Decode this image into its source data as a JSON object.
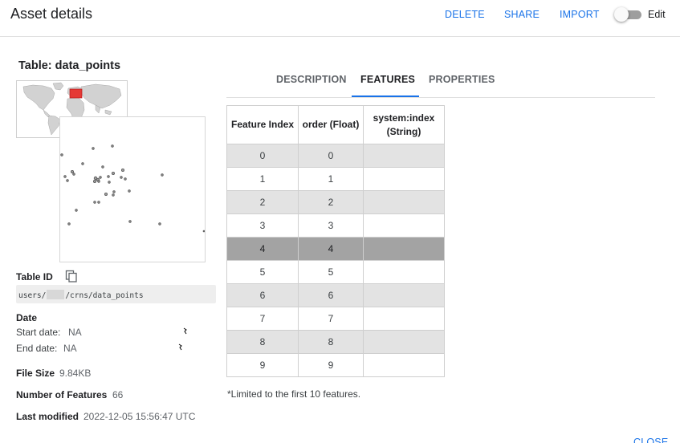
{
  "header": {
    "title": "Asset details",
    "actions": {
      "delete": "DELETE",
      "share": "SHARE",
      "import": "IMPORT"
    },
    "edit_label": "Edit",
    "edit_enabled": false
  },
  "asset": {
    "table_name": "Table: data_points",
    "table_id_label": "Table ID",
    "path_prefix": "users/",
    "path_suffix": "/crns/data_points",
    "date_label": "Date",
    "start_date_label": "Start date:",
    "start_date": "NA",
    "end_date_label": "End date:",
    "end_date": "NA",
    "file_size_label": "File Size",
    "file_size": "9.84KB",
    "num_features_label": "Number of Features",
    "num_features": "66",
    "last_modified_label": "Last modified",
    "last_modified": "2022-12-05 15:56:47 UTC"
  },
  "tabs": {
    "description": "DESCRIPTION",
    "features": "FEATURES",
    "properties": "PROPERTIES",
    "active": "features"
  },
  "features_table": {
    "headers": [
      "Feature Index",
      "order (Float)",
      "system:index",
      "(String)"
    ],
    "rows": [
      [
        "0",
        "0",
        ""
      ],
      [
        "1",
        "1",
        ""
      ],
      [
        "2",
        "2",
        ""
      ],
      [
        "3",
        "3",
        ""
      ],
      [
        "4",
        "4",
        ""
      ],
      [
        "5",
        "5",
        ""
      ],
      [
        "6",
        "6",
        ""
      ],
      [
        "7",
        "7",
        ""
      ],
      [
        "8",
        "8",
        ""
      ],
      [
        "9",
        "9",
        ""
      ]
    ],
    "selected_row": 4
  },
  "note": "*Limited to the first 10 features.",
  "footer": {
    "close": "CLOSE"
  },
  "colors": {
    "accent": "#1a73e8",
    "selected_row": "#a3a3a3",
    "stripe": "#e3e3e3"
  }
}
